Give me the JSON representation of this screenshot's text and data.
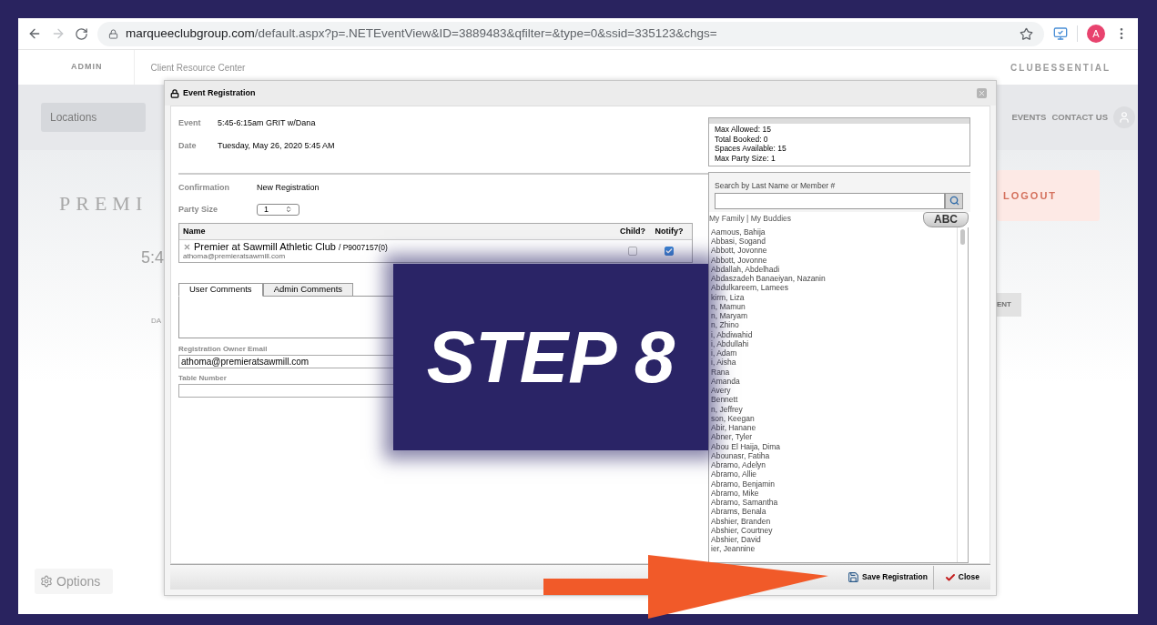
{
  "browser": {
    "url_host": "marqueeclubgroup.com",
    "url_path": "/default.aspx?p=.NETEventView&ID=3889483&qfilter=&type=0&ssid=335123&chgs=",
    "profile_initial": "A",
    "forward_disabled": true
  },
  "background_page": {
    "header_items": [
      "ADMIN",
      "Client Resource Center"
    ],
    "brand": "CLUBESSENTIAL",
    "location_field": "Locations",
    "menu_items": [
      "EVENTS",
      "CONTACT US"
    ],
    "logo_fragment": "PREMI",
    "logout": "LOGOUT",
    "heading_fragment": "5:4",
    "label_fragment": "DA",
    "button_fragment": "ENT",
    "options": "Options"
  },
  "dialog": {
    "title": "Event Registration",
    "details": [
      {
        "label": "Event",
        "value": "5:45-6:15am GRIT w/Dana"
      },
      {
        "label": "Date",
        "value": "Tuesday, May 26, 2020 5:45 AM"
      }
    ],
    "stats": [
      "Max Allowed: 15",
      "Total Booked: 0",
      "Spaces Available: 15",
      "Max Party Size: 1"
    ],
    "confirmation": {
      "label": "Confirmation",
      "value": "New Registration"
    },
    "party_size": {
      "label": "Party Size",
      "value": "1"
    },
    "attendees": {
      "columns": [
        "Name",
        "Child?",
        "Notify?"
      ],
      "rows": [
        {
          "name": "Premier at Sawmill Athletic Club",
          "member_id": "/ P9007157(0)",
          "email": "athoma@premieratsawmill.com",
          "child": false,
          "notify": true
        }
      ]
    },
    "comment_tabs": [
      {
        "label": "User Comments",
        "selected": true
      },
      {
        "label": "Admin Comments",
        "selected": false
      }
    ],
    "owner_email": {
      "label": "Registration Owner Email",
      "value": "athoma@premieratsawmill.com"
    },
    "table_number": {
      "label": "Table Number"
    },
    "search": {
      "label": "Search by Last Name or Member #"
    },
    "quick_links": "My Family | My Buddies",
    "abc_button": "ABC",
    "members": [
      "Aamous, Bahija",
      "Abbasi, Sogand",
      "Abbott, Jovonne",
      "Abbott, Jovonne",
      "Abdallah, Abdelhadi",
      "Abdaszadeh Banaeiyan, Nazanin",
      "Abdulkareem, Lamees",
      "kirm, Liza",
      "n, Mamun",
      "n, Maryam",
      "n, Zhino",
      "i, Abdiwahid",
      "i, Abdullahi",
      "i, Adam",
      "i, Aisha",
      "Rana",
      "Amanda",
      "Avery",
      "Bennett",
      "n, Jeffrey",
      "son, Keegan",
      "Abir, Hanane",
      "Abner, Tyler",
      "Abou El Haija, Dima",
      "Abounasr, Fatiha",
      "Abramo, Adelyn",
      "Abramo, Allie",
      "Abramo, Benjamin",
      "Abramo, Mike",
      "Abramo, Samantha",
      "Abrams, Benala",
      "Abshier, Branden",
      "Abshier, Courtney",
      "Abshier, David",
      "ier, Jeannine"
    ],
    "footer": {
      "save": "Save Registration",
      "close": "Close"
    }
  },
  "tutorial": {
    "caption": "STEP 8"
  }
}
